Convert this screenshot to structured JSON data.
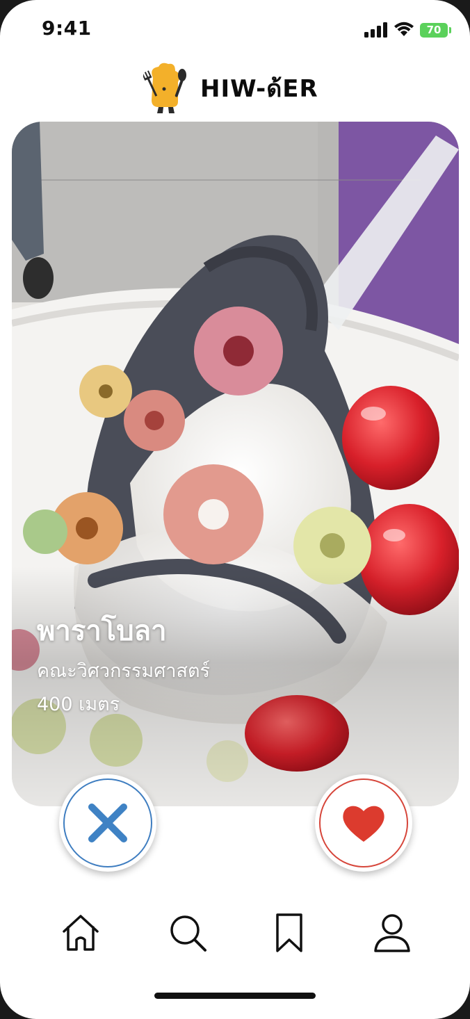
{
  "status_bar": {
    "time": "9:41",
    "battery_level": "70",
    "icons": [
      "signal-icon",
      "wifi-icon",
      "battery-icon"
    ]
  },
  "header": {
    "app_name": "HIW-ด้ER",
    "logo_icon": "chef-mascot-logo"
  },
  "card": {
    "name": "พาราโบลา",
    "faculty": "คณะวิศวกรรมศาสตร์",
    "distance": "400 เมตร",
    "photo": "soft-serve-ice-cream-with-cereal-rings"
  },
  "actions": {
    "dislike_icon": "close-icon",
    "like_icon": "heart-icon",
    "dislike_color": "#3e7dc0",
    "like_color": "#d6453a"
  },
  "tab_bar": {
    "items": [
      {
        "icon": "home-icon"
      },
      {
        "icon": "search-icon"
      },
      {
        "icon": "bookmark-icon"
      },
      {
        "icon": "profile-icon"
      }
    ]
  }
}
